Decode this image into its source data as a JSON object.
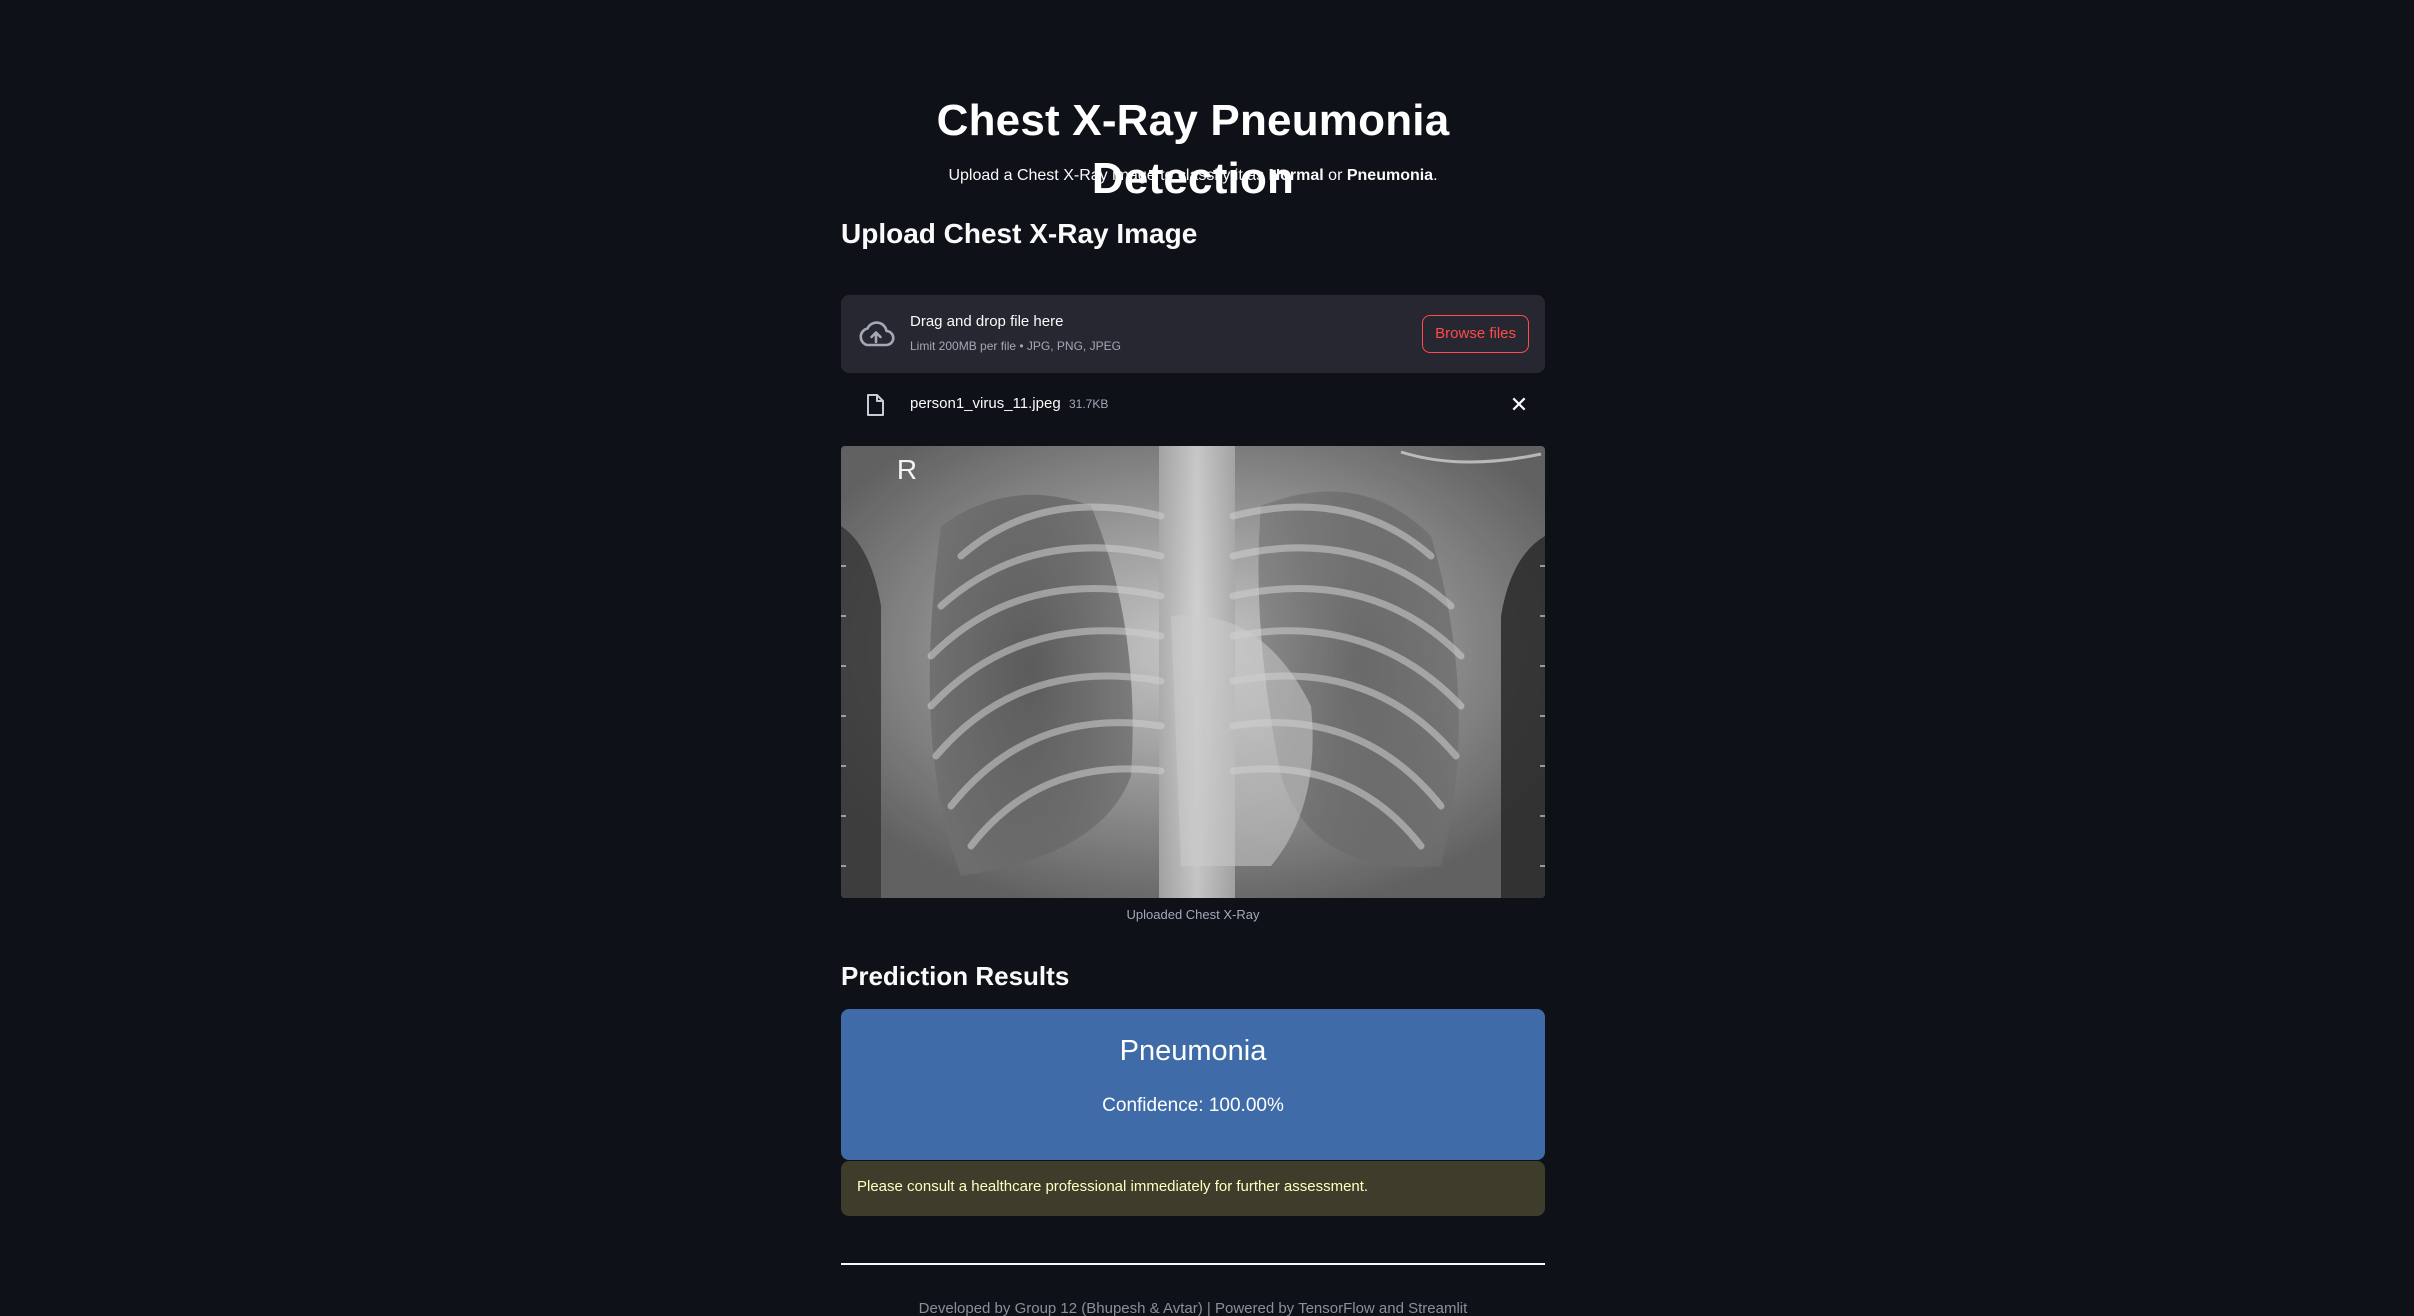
{
  "header": {
    "title": "Chest X-Ray Pneumonia Detection",
    "subtitle_prefix": "Upload a Chest X-Ray image to classify it as ",
    "subtitle_normal": "Normal",
    "subtitle_or": " or ",
    "subtitle_pneumonia": "Pneumonia",
    "subtitle_suffix": "."
  },
  "upload": {
    "heading": "Upload Chest X-Ray Image",
    "dropzone_title": "Drag and drop file here",
    "dropzone_limit": "Limit 200MB per file • JPG, PNG, JPEG",
    "browse_label": "Browse files",
    "icon": "cloud-upload-icon"
  },
  "uploaded_file": {
    "name": "person1_virus_11.jpeg",
    "size": "31.7KB",
    "icon": "file-icon"
  },
  "image": {
    "marker": "R",
    "caption": "Uploaded Chest X-Ray"
  },
  "prediction": {
    "heading": "Prediction Results",
    "label": "Pneumonia",
    "confidence_text": "Confidence: 100.00%",
    "box_color": "#3f6ca8"
  },
  "warning": {
    "text": "Please consult a healthcare professional immediately for further assessment."
  },
  "footer": {
    "text": "Developed by Group 12 (Bhupesh & Avtar) | Powered by TensorFlow and Streamlit"
  },
  "colors": {
    "background": "#0e1117",
    "accent": "#ff4b4b",
    "dropzone": "#262730",
    "warning_bg": "#3e3c2a",
    "warning_text": "#ffffc2"
  }
}
